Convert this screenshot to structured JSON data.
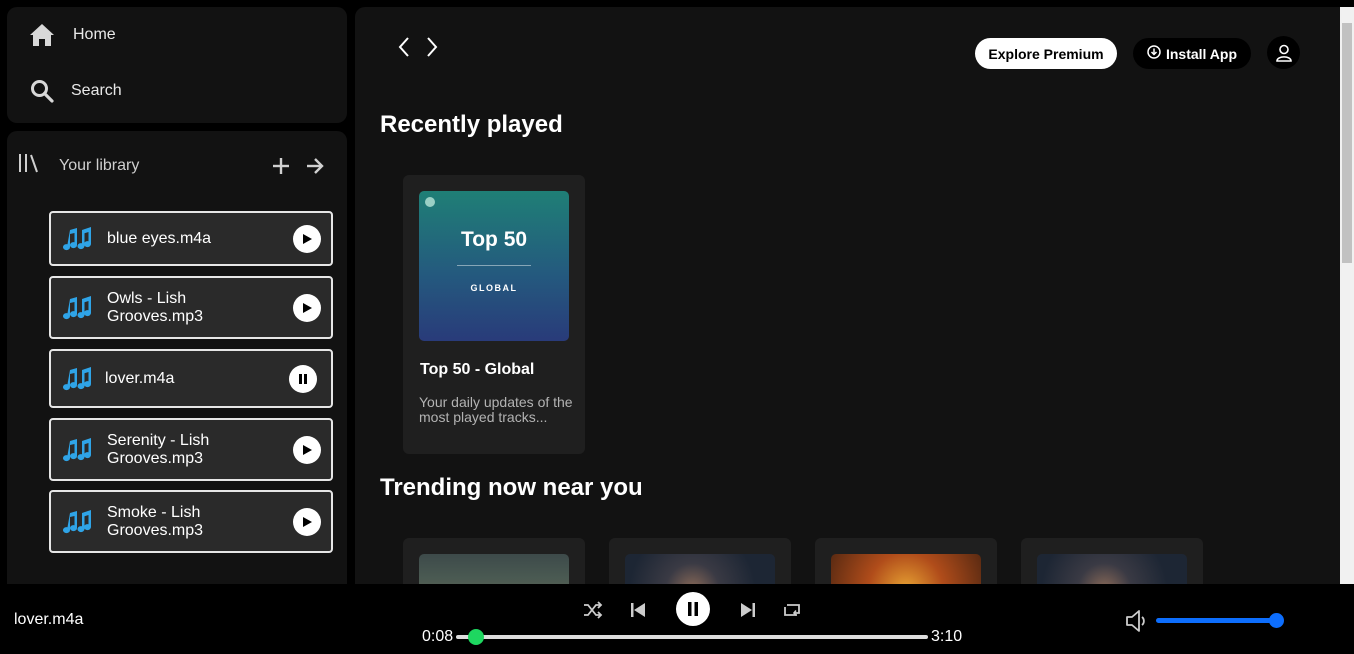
{
  "nav": {
    "home_label": "Home",
    "search_label": "Search"
  },
  "library": {
    "title": "Your library",
    "tracks": [
      {
        "name": "blue eyes.m4a",
        "state": "play"
      },
      {
        "name": "Owls - Lish Grooves.mp3",
        "state": "play"
      },
      {
        "name": "lover.m4a",
        "state": "pause"
      },
      {
        "name": "Serenity - Lish Grooves.mp3",
        "state": "play"
      },
      {
        "name": "Smoke - Lish Grooves.mp3",
        "state": "play"
      }
    ]
  },
  "header": {
    "premium_label": "Explore Premium",
    "install_label": "Install App"
  },
  "recently_played": {
    "title": "Recently played",
    "cards": [
      {
        "cover_title": "Top 50",
        "cover_subtitle": "GLOBAL",
        "title": "Top 50 - Global",
        "description": "Your daily updates of the most played tracks..."
      }
    ]
  },
  "trending": {
    "title": "Trending now near you"
  },
  "player": {
    "now_playing": "lover.m4a",
    "elapsed": "0:08",
    "duration": "3:10",
    "progress_fraction": 0.042,
    "volume_fraction": 1.0
  },
  "colors": {
    "accent_progress": "#1ed760",
    "volume": "#0d6efd",
    "note_icon": "#2fa4e7"
  }
}
